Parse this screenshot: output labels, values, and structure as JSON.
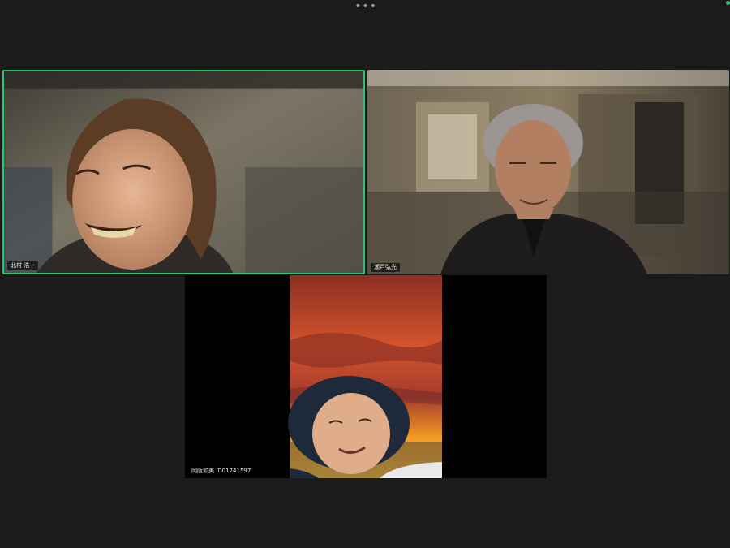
{
  "toolbar": {
    "more_icon": "ellipsis-icon",
    "more_glyph": "•••",
    "connection_color": "#2ec36f"
  },
  "participants": [
    {
      "name": "北村 浩一",
      "active_speaker": true,
      "background": "dim indoor room"
    },
    {
      "name": "瀬戸弘光",
      "active_speaker": false,
      "background": "blurred indoor room"
    },
    {
      "name": "岡阪和美 ID01741597",
      "active_speaker": false,
      "background": "sunset sky"
    }
  ],
  "colors": {
    "app_background": "#1b1b1b",
    "active_border": "#2ec36f",
    "letterbox": "#000000"
  }
}
